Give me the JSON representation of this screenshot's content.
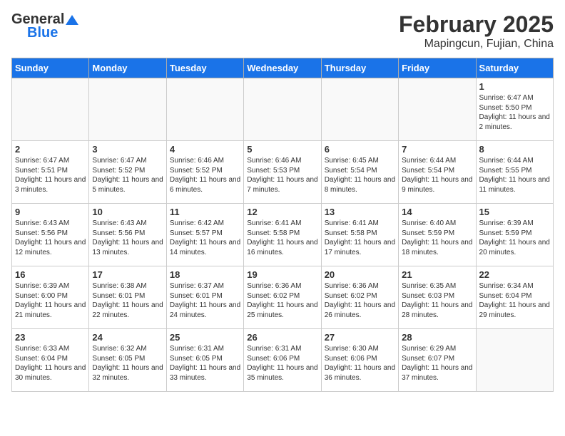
{
  "logo": {
    "general": "General",
    "blue": "Blue"
  },
  "title": {
    "month_year": "February 2025",
    "location": "Mapingcun, Fujian, China"
  },
  "weekdays": [
    "Sunday",
    "Monday",
    "Tuesday",
    "Wednesday",
    "Thursday",
    "Friday",
    "Saturday"
  ],
  "weeks": [
    [
      {
        "day": "",
        "info": ""
      },
      {
        "day": "",
        "info": ""
      },
      {
        "day": "",
        "info": ""
      },
      {
        "day": "",
        "info": ""
      },
      {
        "day": "",
        "info": ""
      },
      {
        "day": "",
        "info": ""
      },
      {
        "day": "1",
        "info": "Sunrise: 6:47 AM\nSunset: 5:50 PM\nDaylight: 11 hours and 2 minutes."
      }
    ],
    [
      {
        "day": "2",
        "info": "Sunrise: 6:47 AM\nSunset: 5:51 PM\nDaylight: 11 hours and 3 minutes."
      },
      {
        "day": "3",
        "info": "Sunrise: 6:47 AM\nSunset: 5:52 PM\nDaylight: 11 hours and 5 minutes."
      },
      {
        "day": "4",
        "info": "Sunrise: 6:46 AM\nSunset: 5:52 PM\nDaylight: 11 hours and 6 minutes."
      },
      {
        "day": "5",
        "info": "Sunrise: 6:46 AM\nSunset: 5:53 PM\nDaylight: 11 hours and 7 minutes."
      },
      {
        "day": "6",
        "info": "Sunrise: 6:45 AM\nSunset: 5:54 PM\nDaylight: 11 hours and 8 minutes."
      },
      {
        "day": "7",
        "info": "Sunrise: 6:44 AM\nSunset: 5:54 PM\nDaylight: 11 hours and 9 minutes."
      },
      {
        "day": "8",
        "info": "Sunrise: 6:44 AM\nSunset: 5:55 PM\nDaylight: 11 hours and 11 minutes."
      }
    ],
    [
      {
        "day": "9",
        "info": "Sunrise: 6:43 AM\nSunset: 5:56 PM\nDaylight: 11 hours and 12 minutes."
      },
      {
        "day": "10",
        "info": "Sunrise: 6:43 AM\nSunset: 5:56 PM\nDaylight: 11 hours and 13 minutes."
      },
      {
        "day": "11",
        "info": "Sunrise: 6:42 AM\nSunset: 5:57 PM\nDaylight: 11 hours and 14 minutes."
      },
      {
        "day": "12",
        "info": "Sunrise: 6:41 AM\nSunset: 5:58 PM\nDaylight: 11 hours and 16 minutes."
      },
      {
        "day": "13",
        "info": "Sunrise: 6:41 AM\nSunset: 5:58 PM\nDaylight: 11 hours and 17 minutes."
      },
      {
        "day": "14",
        "info": "Sunrise: 6:40 AM\nSunset: 5:59 PM\nDaylight: 11 hours and 18 minutes."
      },
      {
        "day": "15",
        "info": "Sunrise: 6:39 AM\nSunset: 5:59 PM\nDaylight: 11 hours and 20 minutes."
      }
    ],
    [
      {
        "day": "16",
        "info": "Sunrise: 6:39 AM\nSunset: 6:00 PM\nDaylight: 11 hours and 21 minutes."
      },
      {
        "day": "17",
        "info": "Sunrise: 6:38 AM\nSunset: 6:01 PM\nDaylight: 11 hours and 22 minutes."
      },
      {
        "day": "18",
        "info": "Sunrise: 6:37 AM\nSunset: 6:01 PM\nDaylight: 11 hours and 24 minutes."
      },
      {
        "day": "19",
        "info": "Sunrise: 6:36 AM\nSunset: 6:02 PM\nDaylight: 11 hours and 25 minutes."
      },
      {
        "day": "20",
        "info": "Sunrise: 6:36 AM\nSunset: 6:02 PM\nDaylight: 11 hours and 26 minutes."
      },
      {
        "day": "21",
        "info": "Sunrise: 6:35 AM\nSunset: 6:03 PM\nDaylight: 11 hours and 28 minutes."
      },
      {
        "day": "22",
        "info": "Sunrise: 6:34 AM\nSunset: 6:04 PM\nDaylight: 11 hours and 29 minutes."
      }
    ],
    [
      {
        "day": "23",
        "info": "Sunrise: 6:33 AM\nSunset: 6:04 PM\nDaylight: 11 hours and 30 minutes."
      },
      {
        "day": "24",
        "info": "Sunrise: 6:32 AM\nSunset: 6:05 PM\nDaylight: 11 hours and 32 minutes."
      },
      {
        "day": "25",
        "info": "Sunrise: 6:31 AM\nSunset: 6:05 PM\nDaylight: 11 hours and 33 minutes."
      },
      {
        "day": "26",
        "info": "Sunrise: 6:31 AM\nSunset: 6:06 PM\nDaylight: 11 hours and 35 minutes."
      },
      {
        "day": "27",
        "info": "Sunrise: 6:30 AM\nSunset: 6:06 PM\nDaylight: 11 hours and 36 minutes."
      },
      {
        "day": "28",
        "info": "Sunrise: 6:29 AM\nSunset: 6:07 PM\nDaylight: 11 hours and 37 minutes."
      },
      {
        "day": "",
        "info": ""
      }
    ]
  ]
}
